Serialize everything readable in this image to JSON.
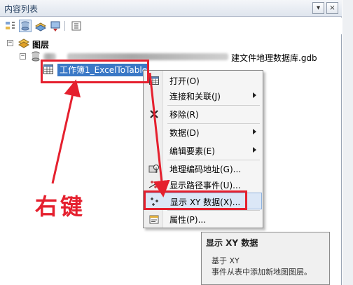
{
  "window": {
    "title": "内容列表",
    "pin_button": "▾",
    "close_button": "×"
  },
  "toolbar": {
    "icons": [
      "list-by-drawing-order-icon",
      "list-by-source-icon",
      "list-by-visibility-icon",
      "list-by-selection-icon",
      "options-icon"
    ]
  },
  "tree": {
    "root": {
      "expander": "−",
      "label": "图层"
    },
    "database": {
      "expander": "−",
      "label": "建文件地理数据库.gdb"
    },
    "table": {
      "label": "工作簿1_ExcelToTable"
    }
  },
  "context_menu": {
    "items": [
      {
        "label": "打开(O)",
        "icon": "table-icon",
        "submenu": false
      },
      {
        "label": "连接和关联(J)",
        "icon": "",
        "submenu": true
      },
      {
        "label": "移除(R)",
        "icon": "remove-icon",
        "submenu": false
      },
      {
        "label": "数据(D)",
        "icon": "",
        "submenu": true
      },
      {
        "label": "编辑要素(E)",
        "icon": "",
        "submenu": true
      },
      {
        "label": "地理编码地址(G)...",
        "icon": "geocode-icon",
        "submenu": false
      },
      {
        "label": "显示路径事件(U)...",
        "icon": "route-events-icon",
        "submenu": false
      },
      {
        "label": "显示 XY 数据(X)...",
        "icon": "xy-data-icon",
        "submenu": false
      },
      {
        "label": "属性(P)...",
        "icon": "properties-icon",
        "submenu": false
      }
    ]
  },
  "tooltip": {
    "title": "显示 XY 数据",
    "line1": "基于 XY",
    "line2": "事件从表中添加新地图图层。"
  },
  "annotation": {
    "text": "右键",
    "color": "#e5202e"
  },
  "colors": {
    "selection": "#3a78c6",
    "highlight": "#e5202e",
    "menu_hover": "#dbe7f7"
  }
}
